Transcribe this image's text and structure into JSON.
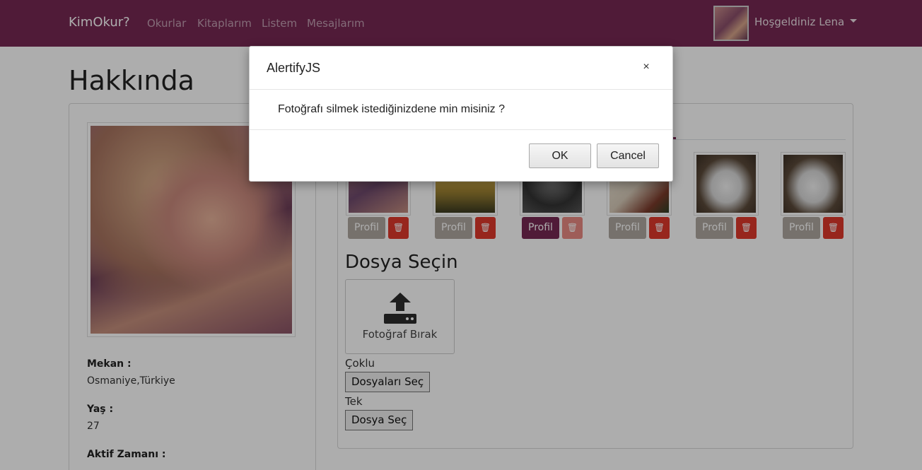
{
  "navbar": {
    "brand": "KimOkur?",
    "links": [
      "Okurlar",
      "Kitaplarım",
      "Listem",
      "Mesajlarım"
    ],
    "user_greeting": "Hoşgeldiniz Lena"
  },
  "page": {
    "title": "Hakkında"
  },
  "profile": {
    "location_label": "Mekan :",
    "location_value": "Osmaniye,Türkiye",
    "age_label": "Yaş :",
    "age_value": "27",
    "active_label": "Aktif Zamanı :"
  },
  "photos": {
    "profile_label": "Profil",
    "delete_icon": "trash-icon"
  },
  "upload": {
    "title": "Dosya Seçin",
    "dropzone_text": "Fotoğraf Bırak",
    "multi_label": "Çoklu",
    "multi_button": "Dosyaları Seç",
    "single_label": "Tek",
    "single_button": "Dosya Seç"
  },
  "dialog": {
    "title": "AlertifyJS",
    "message": "Fotoğrafı silmek istediğinizdene min misiniz ?",
    "ok_label": "OK",
    "cancel_label": "Cancel",
    "close_symbol": "×"
  },
  "colors": {
    "navbar": "#772953",
    "profil_button": "#aea79f",
    "delete_button": "#df382c"
  }
}
